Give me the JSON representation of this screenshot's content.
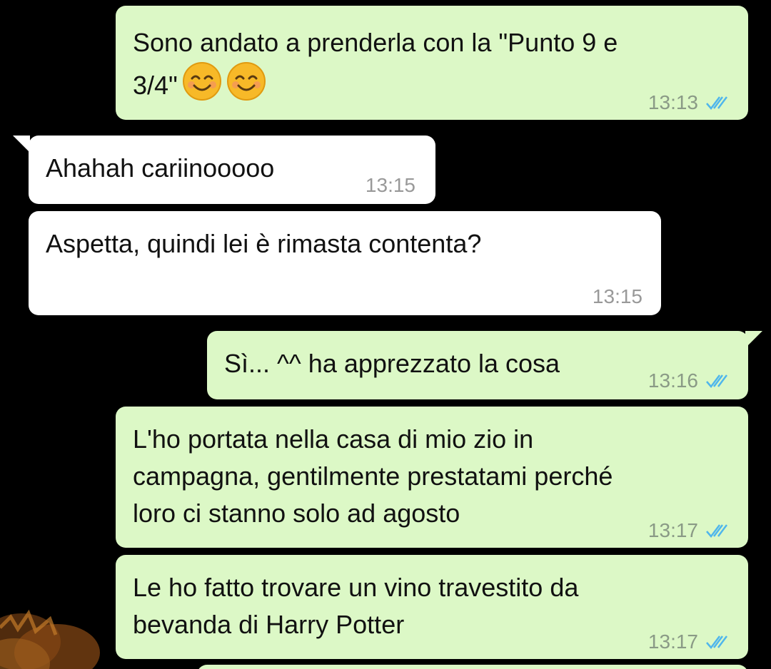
{
  "messages": [
    {
      "direction": "outgoing",
      "lines": [
        "Sono andato a prenderla con la \"Punto 9 e",
        "3/4\""
      ],
      "emoji": [
        "smiling-face-icon",
        "smiling-face-icon"
      ],
      "time": "13:13",
      "status": "read"
    },
    {
      "direction": "incoming",
      "lines": [
        "Ahahah cariinooooo"
      ],
      "time": "13:15"
    },
    {
      "direction": "incoming",
      "lines": [
        "Aspetta, quindi lei è rimasta contenta?"
      ],
      "time": "13:15"
    },
    {
      "direction": "outgoing",
      "lines": [
        "Sì... ^^ ha apprezzato la cosa"
      ],
      "time": "13:16",
      "status": "read"
    },
    {
      "direction": "outgoing",
      "lines": [
        "L'ho portata nella casa di mio zio in",
        "campagna, gentilmente prestatami perché",
        "loro ci stanno solo ad agosto"
      ],
      "time": "13:17",
      "status": "read"
    },
    {
      "direction": "outgoing",
      "lines": [
        "Le ho fatto trovare un vino travestito da",
        "bevanda di Harry Potter"
      ],
      "time": "13:17",
      "status": "read"
    }
  ],
  "colors": {
    "outgoing_bubble": "#dcf8c6",
    "incoming_bubble": "#ffffff",
    "read_ticks": "#4fb6ec",
    "background": "#000000"
  }
}
